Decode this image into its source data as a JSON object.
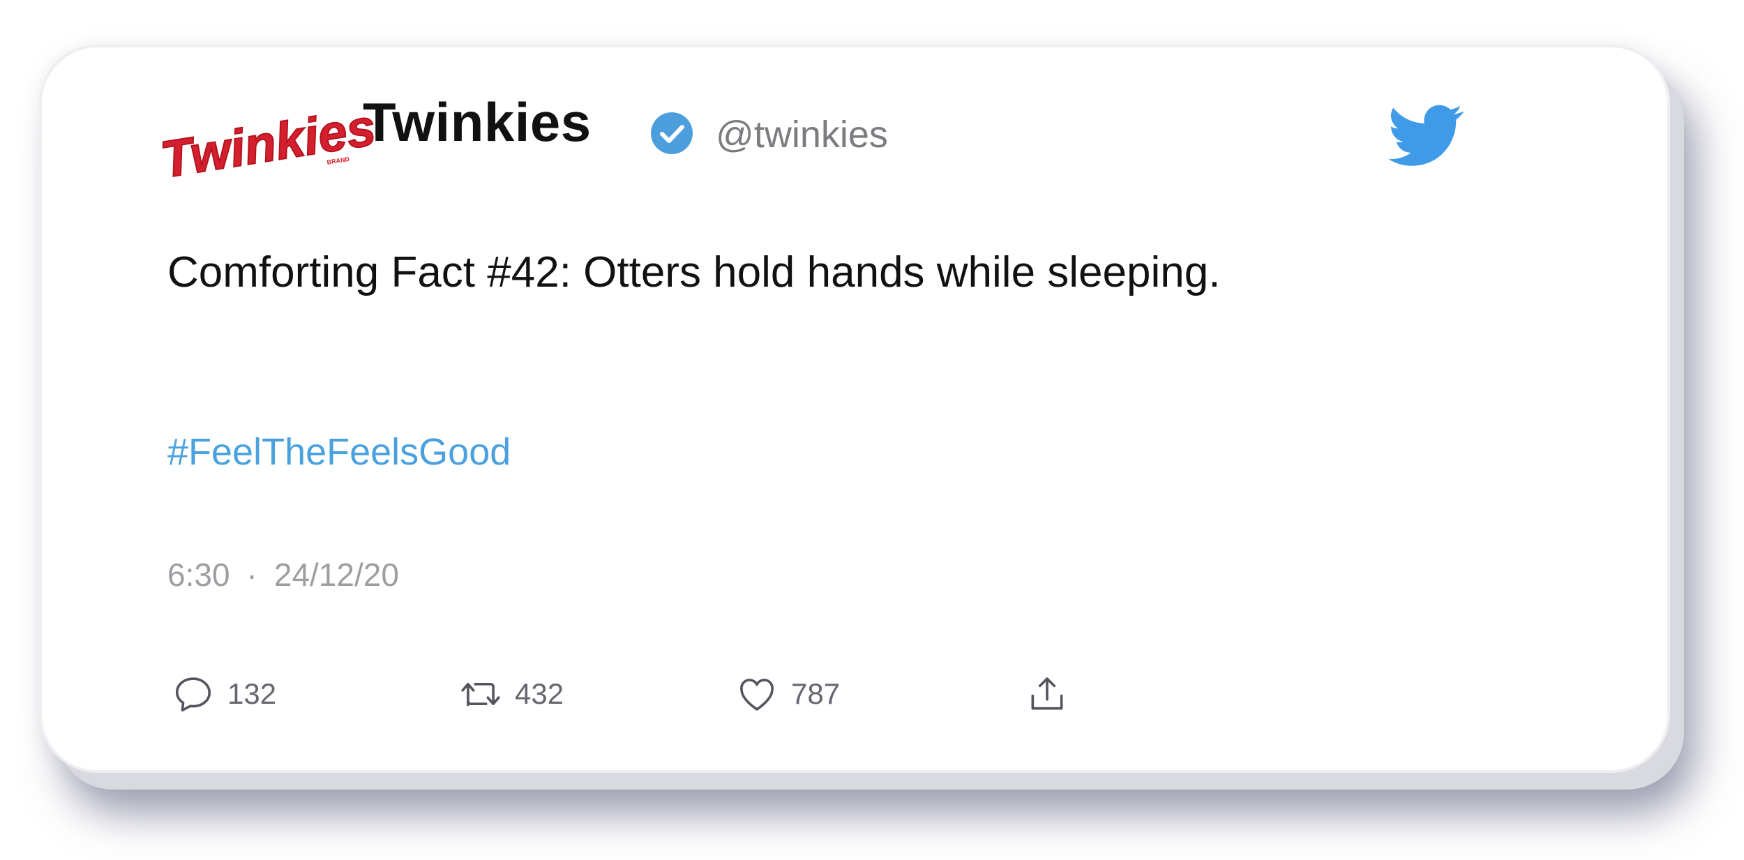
{
  "tweet": {
    "author": {
      "logo_text": "Twinkies",
      "logo_small_text": "BRAND",
      "display_name": "Twinkies",
      "handle": "@twinkies",
      "verified": true
    },
    "text": "Comforting Fact #42: Otters hold hands while sleeping.",
    "hashtag": "#FeelTheFeelsGood",
    "time": "6:30",
    "separator": "·",
    "date": "24/12/20",
    "actions": {
      "replies": "132",
      "retweets": "432",
      "likes": "787"
    }
  },
  "icons": {
    "brand": "twitter-bird-icon",
    "verified": "verified-badge-icon",
    "reply": "reply-icon",
    "retweet": "retweet-icon",
    "like": "heart-icon",
    "share": "share-icon"
  },
  "colors": {
    "accent_blue": "#4aa1dd",
    "twitter_blue": "#3f9be8",
    "logo_red": "#d4202e",
    "text_primary": "#111111",
    "text_secondary": "#7b7b80",
    "meta_gray": "#9d9da2"
  }
}
